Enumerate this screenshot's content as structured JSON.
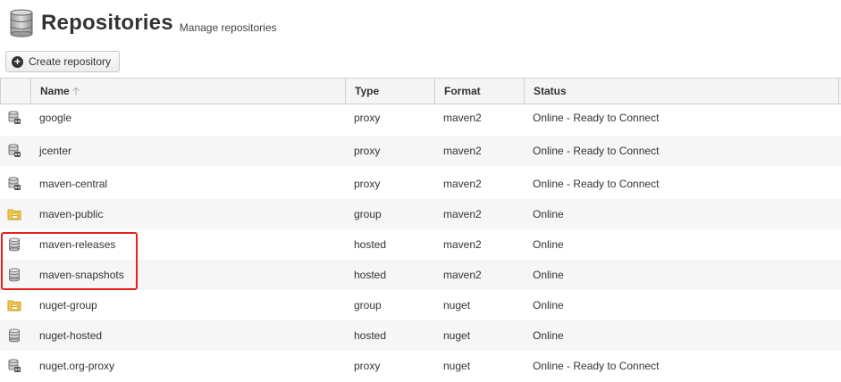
{
  "header": {
    "title": "Repositories",
    "subtitle": "Manage repositories"
  },
  "toolbar": {
    "create_label": "Create repository"
  },
  "table": {
    "columns": [
      "Name",
      "Type",
      "Format",
      "Status"
    ],
    "sort_column": "Name",
    "sort_direction": "ascending",
    "rows": [
      {
        "name": "google",
        "type": "proxy",
        "format": "maven2",
        "status": "Online - Ready to Connect",
        "icon": "proxy-repo-icon"
      },
      {
        "name": "jcenter",
        "type": "proxy",
        "format": "maven2",
        "status": "Online - Ready to Connect",
        "icon": "proxy-repo-icon"
      },
      {
        "name": "maven-central",
        "type": "proxy",
        "format": "maven2",
        "status": "Online - Ready to Connect",
        "icon": "proxy-repo-icon"
      },
      {
        "name": "maven-public",
        "type": "group",
        "format": "maven2",
        "status": "Online",
        "icon": "group-repo-icon"
      },
      {
        "name": "maven-releases",
        "type": "hosted",
        "format": "maven2",
        "status": "Online",
        "icon": "hosted-repo-icon"
      },
      {
        "name": "maven-snapshots",
        "type": "hosted",
        "format": "maven2",
        "status": "Online",
        "icon": "hosted-repo-icon"
      },
      {
        "name": "nuget-group",
        "type": "group",
        "format": "nuget",
        "status": "Online",
        "icon": "group-repo-icon"
      },
      {
        "name": "nuget-hosted",
        "type": "hosted",
        "format": "nuget",
        "status": "Online",
        "icon": "hosted-repo-icon"
      },
      {
        "name": "nuget.org-proxy",
        "type": "proxy",
        "format": "nuget",
        "status": "Online - Ready to Connect",
        "icon": "proxy-repo-icon"
      }
    ]
  },
  "colors": {
    "highlight": "#e8201a",
    "header_bg": "#f5f5f5",
    "row_alt_bg": "#f6f6f6"
  }
}
